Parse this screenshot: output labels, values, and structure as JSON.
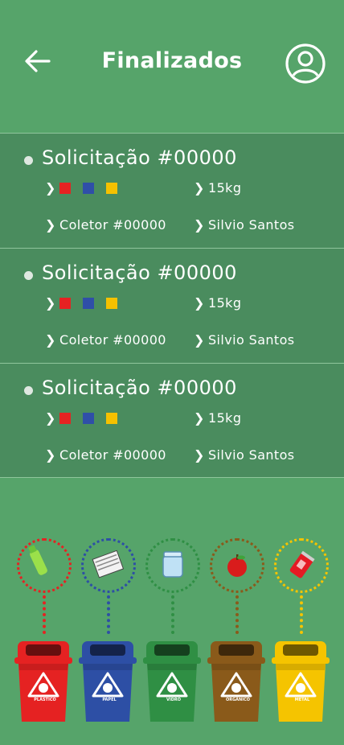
{
  "header": {
    "title": "Finalizados"
  },
  "requests": [
    {
      "title": "Solicitação #00000",
      "weight": "15kg",
      "collector": "Coletor #00000",
      "name": "Silvio Santos",
      "colors": [
        "#e62222",
        "#2f4fa8",
        "#f5c100"
      ]
    },
    {
      "title": "Solicitação #00000",
      "weight": "15kg",
      "collector": "Coletor #00000",
      "name": "Silvio Santos",
      "colors": [
        "#e62222",
        "#2f4fa8",
        "#f5c100"
      ]
    },
    {
      "title": "Solicitação #00000",
      "weight": "15kg",
      "collector": "Coletor #00000",
      "name": "Silvio Santos",
      "colors": [
        "#e62222",
        "#2f4fa8",
        "#f5c100"
      ]
    }
  ],
  "bins": [
    {
      "label": "PLÁSTICO",
      "color": "#e52222",
      "icon": "plastic-bottle-icon"
    },
    {
      "label": "PAPEL",
      "color": "#2d4fa5",
      "icon": "paper-icon"
    },
    {
      "label": "VIDRO",
      "color": "#2f8f44",
      "icon": "glass-jar-icon"
    },
    {
      "label": "ORGÂNICO",
      "color": "#8a5a1a",
      "icon": "apple-icon"
    },
    {
      "label": "METAL",
      "color": "#f5c400",
      "icon": "can-icon"
    }
  ]
}
